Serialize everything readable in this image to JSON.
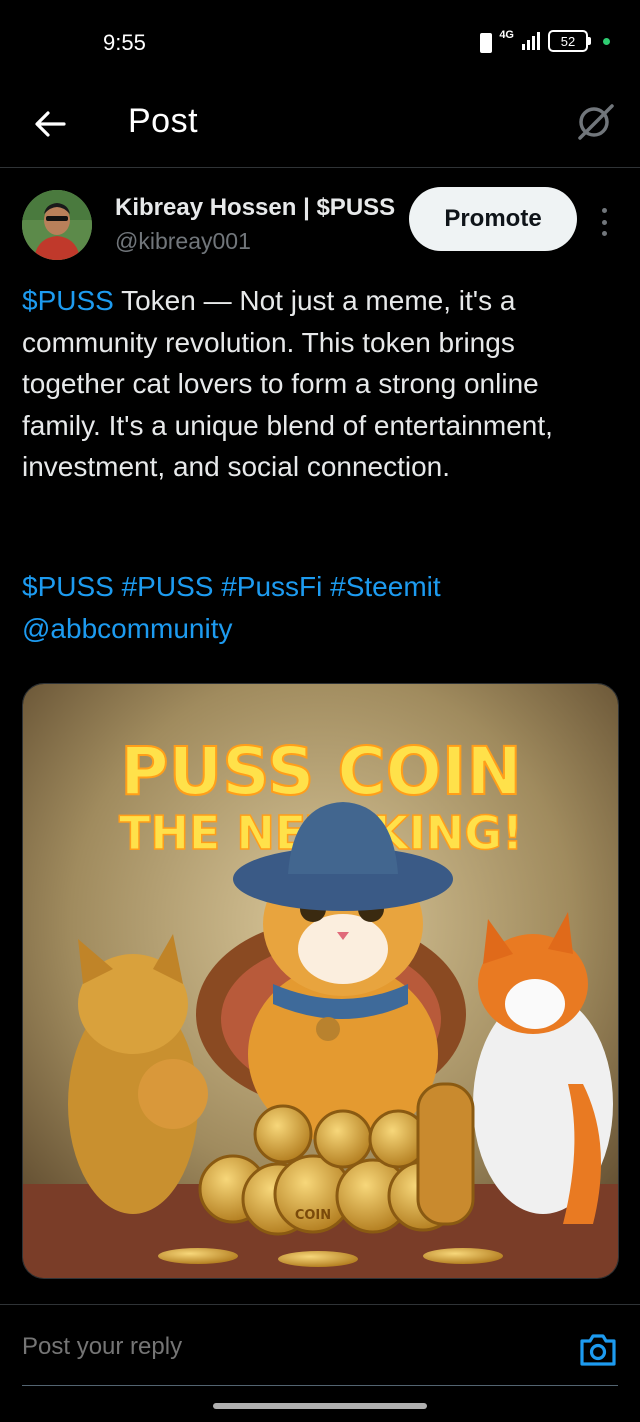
{
  "status_bar": {
    "time": "9:55",
    "network": "4G",
    "battery": "52",
    "dot_color": "#2ecc71"
  },
  "header": {
    "back_icon": "back-arrow-icon",
    "title": "Post",
    "grok_icon": "grok-icon"
  },
  "post": {
    "author_name": "Kibreay Hossen | $PUSS",
    "author_handle": "@kibreay001",
    "promote_label": "Promote",
    "more_icon": "more-vertical-icon",
    "text_link": "$PUSS",
    "text_body": " Token — Not just a meme, it's a community revolution. This token brings together cat lovers to form a strong online family. It's a unique blend of entertainment, investment, and social connection.",
    "hashtags": [
      "$PUSS",
      "#PUSS",
      "#PussFi",
      "#Steemit"
    ],
    "mention": "@abbcommunity",
    "image": {
      "headline_line1": "PUSS COIN",
      "headline_line2": "THE NEW KING!",
      "coin_label": "COIN"
    }
  },
  "reply": {
    "placeholder": "Post your reply",
    "camera_icon": "camera-icon"
  },
  "colors": {
    "link": "#1d9bf0",
    "background": "#000000",
    "text": "#e7e9ea",
    "muted": "#71767b"
  }
}
